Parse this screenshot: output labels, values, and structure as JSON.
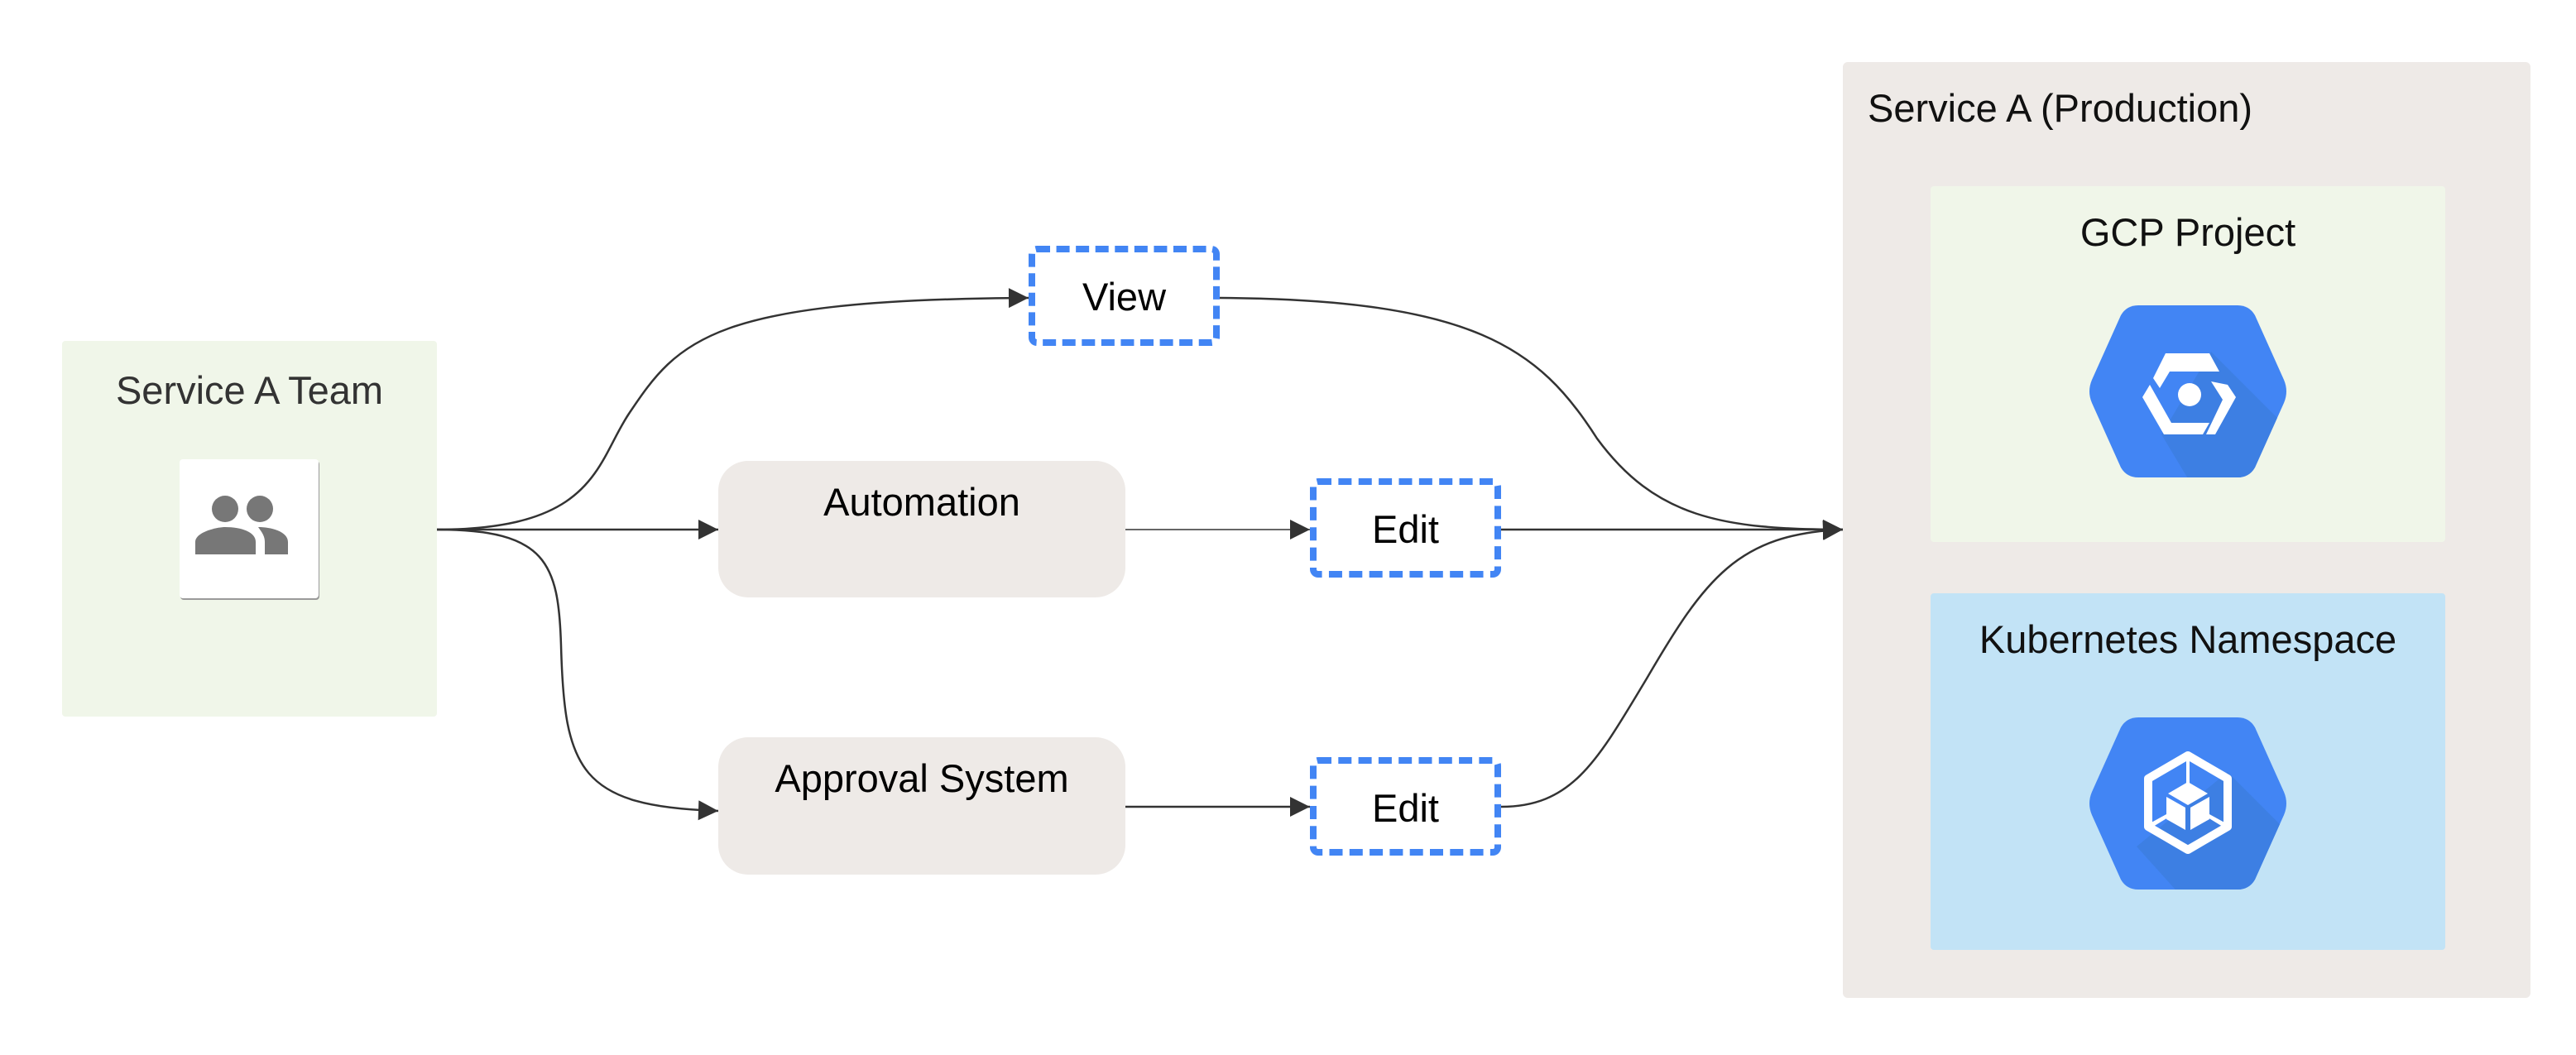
{
  "diagram": {
    "team": {
      "title": "Service A Team",
      "icon": "people-icon"
    },
    "processes": [
      {
        "id": "automation",
        "label": "Automation"
      },
      {
        "id": "approval",
        "label": "Approval System"
      }
    ],
    "permissions": [
      {
        "id": "view",
        "label": "View"
      },
      {
        "id": "edit-automation",
        "label": "Edit"
      },
      {
        "id": "edit-approval",
        "label": "Edit"
      }
    ],
    "production": {
      "title": "Service A (Production)",
      "resources": [
        {
          "id": "gcp",
          "label": "GCP Project",
          "icon": "gcp-project-icon"
        },
        {
          "id": "k8s",
          "label": "Kubernetes Namespace",
          "icon": "kubernetes-namespace-icon"
        }
      ]
    },
    "edges": [
      {
        "from": "team",
        "to": "view"
      },
      {
        "from": "team",
        "to": "automation"
      },
      {
        "from": "team",
        "to": "approval"
      },
      {
        "from": "automation",
        "to": "edit-automation"
      },
      {
        "from": "approval",
        "to": "edit-approval"
      },
      {
        "from": "view",
        "to": "production"
      },
      {
        "from": "edit-automation",
        "to": "production"
      },
      {
        "from": "edit-approval",
        "to": "production"
      }
    ],
    "colors": {
      "team_bg": "#f0f6e9",
      "production_bg": "#eeeae7",
      "gcp_bg": "#f0f6e9",
      "k8s_bg": "#c2e3f6",
      "process_bg": "#eeeae7",
      "permission_border": "#4285f4",
      "icon_blue": "#4285f4",
      "people_gray": "#777777"
    }
  }
}
